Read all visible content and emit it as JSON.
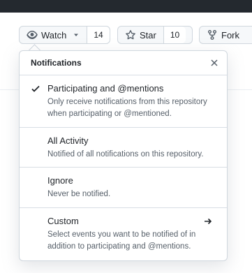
{
  "watch_button": {
    "label": "Watch",
    "count": "14"
  },
  "star_button": {
    "label": "Star",
    "count": "10"
  },
  "fork_button": {
    "label": "Fork"
  },
  "popover": {
    "title": "Notifications",
    "items": [
      {
        "title": "Participating and @mentions",
        "desc": "Only receive notifications from this repository when participating or @mentioned.",
        "selected": true
      },
      {
        "title": "All Activity",
        "desc": "Notified of all notifications on this repository."
      },
      {
        "title": "Ignore",
        "desc": "Never be notified."
      },
      {
        "title": "Custom",
        "desc": "Select events you want to be notified of in addition to participating and @mentions."
      }
    ]
  },
  "icons": {
    "watch": "eye-icon",
    "dropdown": "triangle-down-icon",
    "star": "star-icon",
    "fork": "repo-forked-icon",
    "close": "x-icon",
    "check": "check-icon",
    "arrow": "arrow-right-icon"
  },
  "colors": {
    "topbar": "#24292f",
    "border": "#d0d7de",
    "text": "#1f2328",
    "muted": "#57606a"
  }
}
